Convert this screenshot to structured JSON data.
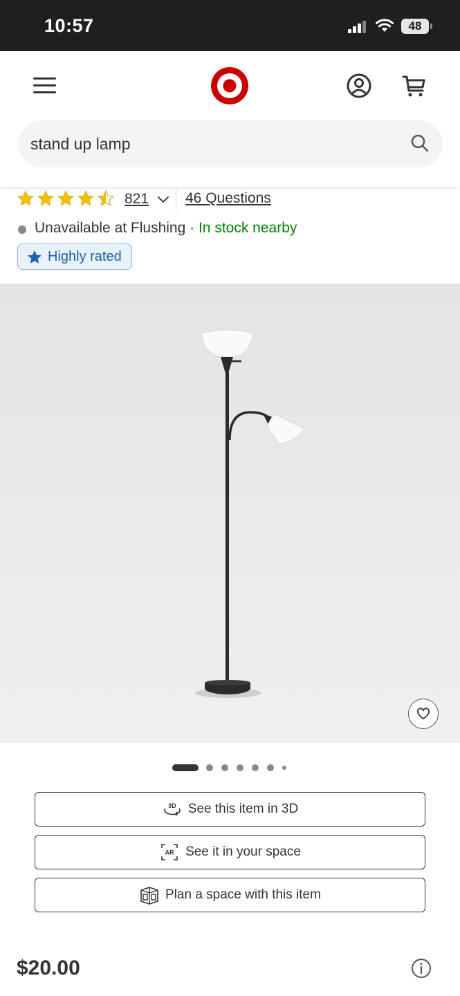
{
  "status_bar": {
    "time": "10:57",
    "battery": "48"
  },
  "header": {
    "brand_color": "#cc0000",
    "search": {
      "value": "stand up lamp"
    }
  },
  "product": {
    "rating": 4.5,
    "rating_count": "821",
    "questions_link": "46 Questions",
    "availability": {
      "status": "Unavailable at Flushing",
      "separator": " · ",
      "nearby": "In stock nearby"
    },
    "badge": "Highly rated",
    "image_count": 7,
    "active_image": 1,
    "actions": [
      {
        "label": "See this item in 3D",
        "icon": "3d-rotate-icon"
      },
      {
        "label": "See it in your space",
        "icon": "ar-icon"
      },
      {
        "label": "Plan a space with this item",
        "icon": "plan-room-icon"
      }
    ],
    "price": "$20.00"
  },
  "colors": {
    "star": "#f5c000",
    "in_stock": "#008300",
    "badge_text": "#1f5fad"
  }
}
